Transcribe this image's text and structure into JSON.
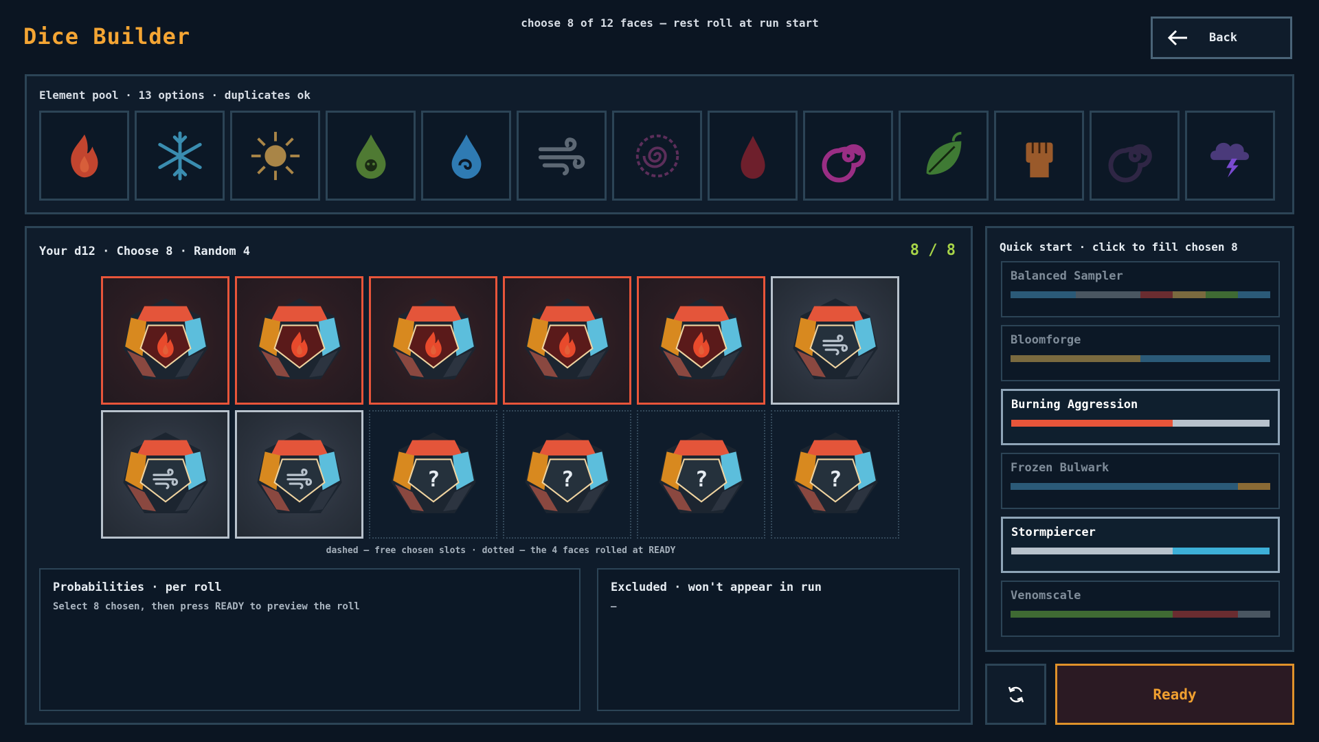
{
  "header": {
    "title": "Dice Builder",
    "subtitle": "choose 8 of 12 faces — rest roll at run start",
    "back_label": "Back"
  },
  "pool": {
    "label": "Element pool · 13 options · duplicates ok",
    "elements": [
      {
        "name": "fire",
        "icon": "fire-icon",
        "color": "#c2452f"
      },
      {
        "name": "frost",
        "icon": "snowflake-icon",
        "color": "#3a8db0"
      },
      {
        "name": "sun",
        "icon": "sun-icon",
        "color": "#a98547"
      },
      {
        "name": "poison",
        "icon": "poison-drop-icon",
        "color": "#4f7a33"
      },
      {
        "name": "water",
        "icon": "water-drop-icon",
        "color": "#2f7bb3"
      },
      {
        "name": "wind",
        "icon": "wind-icon",
        "color": "#5d6874"
      },
      {
        "name": "arcane",
        "icon": "arcane-sigil-icon",
        "color": "#5c2e5a"
      },
      {
        "name": "blood",
        "icon": "blood-drop-icon",
        "color": "#6e1f2c"
      },
      {
        "name": "vortex",
        "icon": "vortex-icon",
        "color": "#9a2e84"
      },
      {
        "name": "nature",
        "icon": "leaf-icon",
        "color": "#3f7a34"
      },
      {
        "name": "strength",
        "icon": "fist-icon",
        "color": "#9a5a2b"
      },
      {
        "name": "void",
        "icon": "void-swirl-icon",
        "color": "#2f2645"
      },
      {
        "name": "storm",
        "icon": "storm-cloud-icon",
        "color": "#4a3a7a"
      }
    ]
  },
  "dice": {
    "label": "Your d12 · Choose 8 · Random 4",
    "counter": "8 / 8",
    "slots": [
      {
        "type": "fire",
        "icon": "fire-icon"
      },
      {
        "type": "fire",
        "icon": "fire-icon"
      },
      {
        "type": "fire",
        "icon": "fire-icon"
      },
      {
        "type": "fire",
        "icon": "fire-icon"
      },
      {
        "type": "fire",
        "icon": "fire-icon"
      },
      {
        "type": "wind",
        "icon": "wind-icon"
      },
      {
        "type": "wind",
        "icon": "wind-icon"
      },
      {
        "type": "wind",
        "icon": "wind-icon"
      },
      {
        "type": "random",
        "icon": "question-mark-icon"
      },
      {
        "type": "random",
        "icon": "question-mark-icon"
      },
      {
        "type": "random",
        "icon": "question-mark-icon"
      },
      {
        "type": "random",
        "icon": "question-mark-icon"
      }
    ],
    "caption": "dashed — free chosen slots · dotted — the 4 faces rolled at READY"
  },
  "probabilities": {
    "title": "Probabilities · per roll",
    "body": "Select 8 chosen, then press READY to preview the roll"
  },
  "excluded": {
    "title": "Excluded · won't appear in run",
    "body": "—"
  },
  "quick_start": {
    "label": "Quick start · click to fill chosen 8",
    "presets": [
      {
        "name": "Balanced Sampler",
        "active": false,
        "bar": [
          {
            "frac": 0.25,
            "color": "#2b5a78"
          },
          {
            "frac": 0.25,
            "color": "#4a5661"
          },
          {
            "frac": 0.125,
            "color": "#6a2c30"
          },
          {
            "frac": 0.125,
            "color": "#7a6a3f"
          },
          {
            "frac": 0.125,
            "color": "#3f6a33"
          },
          {
            "frac": 0.125,
            "color": "#2b5a78"
          }
        ]
      },
      {
        "name": "Bloomforge",
        "active": false,
        "bar": [
          {
            "frac": 0.5,
            "color": "#7a6a3f"
          },
          {
            "frac": 0.375,
            "color": "#2b5a78"
          },
          {
            "frac": 0.125,
            "color": "#2b5a78"
          }
        ]
      },
      {
        "name": "Burning Aggression",
        "active": true,
        "bar": [
          {
            "frac": 0.625,
            "color": "#e8553a"
          },
          {
            "frac": 0.375,
            "color": "#b8c2cc"
          }
        ]
      },
      {
        "name": "Frozen Bulwark",
        "active": false,
        "bar": [
          {
            "frac": 0.5,
            "color": "#2b5a78"
          },
          {
            "frac": 0.375,
            "color": "#2b5a78"
          },
          {
            "frac": 0.125,
            "color": "#8a6a35"
          }
        ]
      },
      {
        "name": "Stormpiercer",
        "active": true,
        "bar": [
          {
            "frac": 0.625,
            "color": "#b8c2cc"
          },
          {
            "frac": 0.375,
            "color": "#3db0d8"
          }
        ]
      },
      {
        "name": "Venomscale",
        "active": false,
        "bar": [
          {
            "frac": 0.625,
            "color": "#3f6a33"
          },
          {
            "frac": 0.25,
            "color": "#6a2c30"
          },
          {
            "frac": 0.125,
            "color": "#4a5661"
          }
        ]
      }
    ]
  },
  "actions": {
    "refresh_icon": "refresh-icon",
    "ready_label": "Ready"
  }
}
